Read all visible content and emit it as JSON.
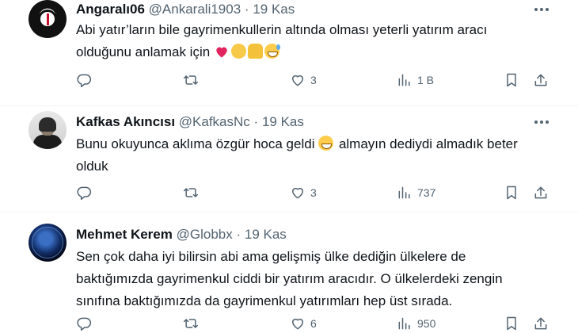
{
  "tweets": [
    {
      "name": "Angaralı06",
      "handle": "@Ankarali1903",
      "separator": "·",
      "date": "19 Kas",
      "text_line1": "Abi yatır’ların bile gayrimenkullerin altında olması yeterli yatırım aracı",
      "text_line2": "olduğunu anlamak için",
      "emojis": [
        "heart",
        "clapping-hands",
        "folded-hands",
        "grinning-sweat"
      ],
      "replies": "",
      "retweets": "",
      "likes": "3",
      "views": "1 B"
    },
    {
      "name": "Kafkas Akıncısı",
      "handle": "@KafkasNc",
      "separator": "·",
      "date": "19 Kas",
      "text_part1": "Bunu okuyunca aklıma özgür hoca geldi",
      "emoji": "grinning-face",
      "text_part2": "almayın dediydi almadık beter",
      "text_line2": "olduk",
      "replies": "",
      "retweets": "",
      "likes": "3",
      "views": "737"
    },
    {
      "name": "Mehmet Kerem",
      "handle": "@Globbx",
      "separator": "·",
      "date": "19 Kas",
      "text_line1": "Sen çok daha iyi bilirsin abi ama gelişmiş ülke dediğin ülkelere de",
      "text_line2": "baktığımızda gayrimenkul ciddi bir yatırım aracıdır. O ülkelerdeki zengin",
      "text_line3": "sınıfına baktığımızda da gayrimenkul yatırımları hep üst sırada.",
      "replies": "",
      "retweets": "",
      "likes": "6",
      "views": "950"
    }
  ],
  "colors": {
    "text": "#0f1419",
    "muted": "#536471",
    "heart": "#f91880",
    "border": "#eff3f4"
  },
  "icons": [
    "reply-icon",
    "retweet-icon",
    "like-icon",
    "views-icon",
    "bookmark-icon",
    "share-icon",
    "more-icon"
  ]
}
